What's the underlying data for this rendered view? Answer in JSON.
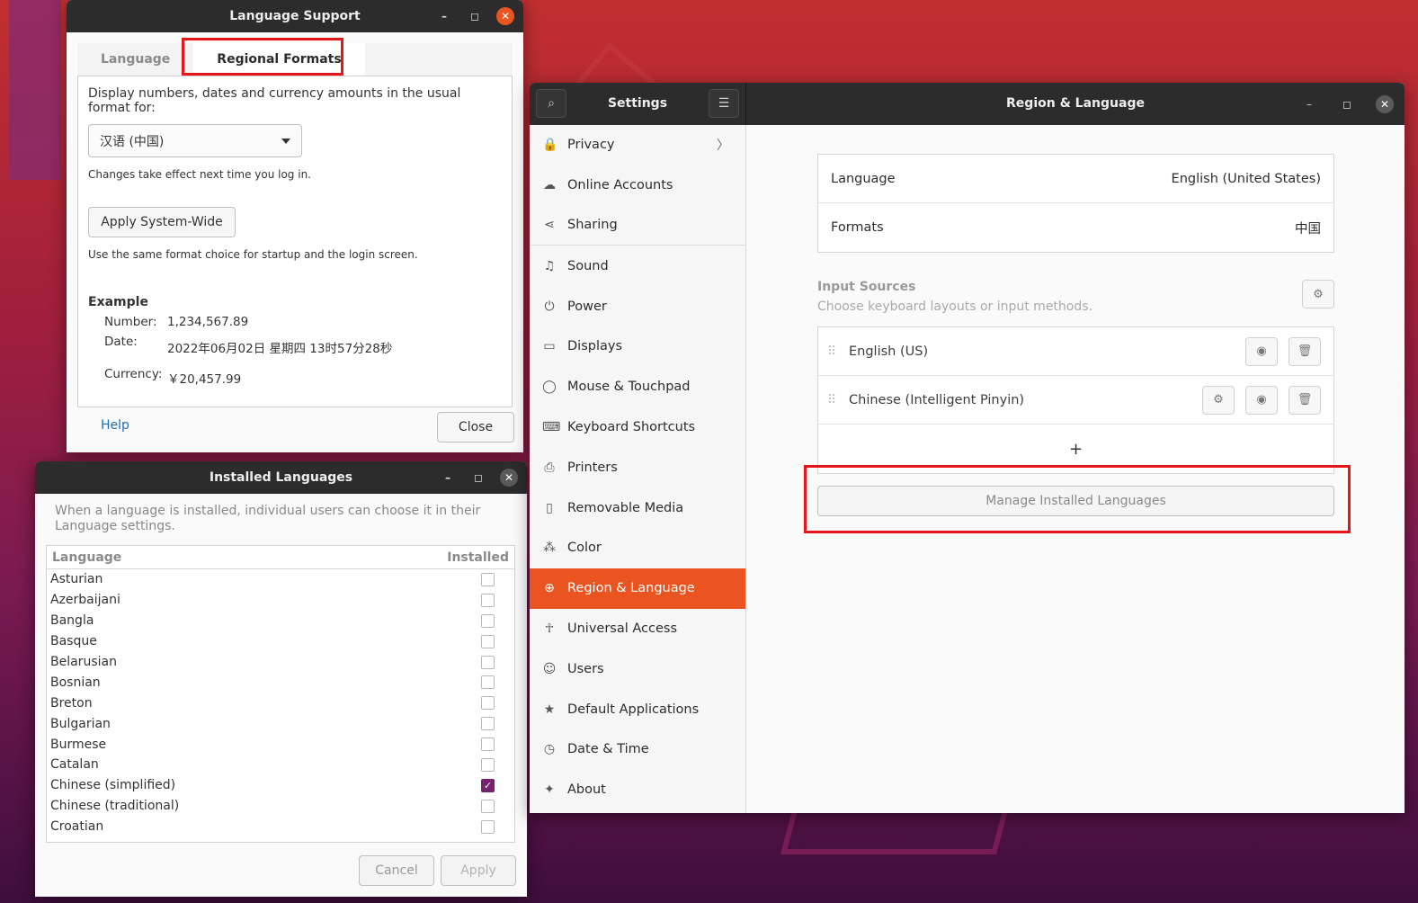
{
  "language_support": {
    "title": "Language Support",
    "tabs": [
      "Language",
      "Regional Formats"
    ],
    "prompt": "Display numbers, dates and currency amounts in the usual format for:",
    "selected_format": "汉语 (中国)",
    "note1": "Changes take effect next time you log in.",
    "apply_button": "Apply System-Wide",
    "note2": "Use the same format choice for startup and the login screen.",
    "example_title": "Example",
    "number_label": "Number:",
    "number_value": "1,234,567.89",
    "date_label": "Date:",
    "date_value": "2022年06月02日 星期四 13时57分28秒",
    "currency_label": "Currency:",
    "currency_value": "￥20,457.99",
    "help": "Help",
    "close": "Close"
  },
  "installed_languages": {
    "title": "Installed Languages",
    "description": "When a language is installed, individual users can choose it in their Language settings.",
    "col_language": "Language",
    "col_installed": "Installed",
    "rows": [
      {
        "name": "Asturian",
        "installed": false
      },
      {
        "name": "Azerbaijani",
        "installed": false
      },
      {
        "name": "Bangla",
        "installed": false
      },
      {
        "name": "Basque",
        "installed": false
      },
      {
        "name": "Belarusian",
        "installed": false
      },
      {
        "name": "Bosnian",
        "installed": false
      },
      {
        "name": "Breton",
        "installed": false
      },
      {
        "name": "Bulgarian",
        "installed": false
      },
      {
        "name": "Burmese",
        "installed": false
      },
      {
        "name": "Catalan",
        "installed": false
      },
      {
        "name": "Chinese (simplified)",
        "installed": true
      },
      {
        "name": "Chinese (traditional)",
        "installed": false
      },
      {
        "name": "Croatian",
        "installed": false
      }
    ],
    "cancel": "Cancel",
    "apply": "Apply"
  },
  "settings": {
    "title": "Settings",
    "page_title": "Region & Language",
    "sidebar": [
      {
        "label": "Privacy",
        "icon": "lock-icon",
        "glyph": "🔒",
        "chevron": true
      },
      {
        "label": "Online Accounts",
        "icon": "cloud-icon",
        "glyph": "☁"
      },
      {
        "label": "Sharing",
        "icon": "share-icon",
        "glyph": "⋖"
      },
      {
        "label": "Sound",
        "icon": "music-icon",
        "glyph": "♫"
      },
      {
        "label": "Power",
        "icon": "power-icon",
        "glyph": "⏻"
      },
      {
        "label": "Displays",
        "icon": "display-icon",
        "glyph": "▭"
      },
      {
        "label": "Mouse & Touchpad",
        "icon": "mouse-icon",
        "glyph": "◯"
      },
      {
        "label": "Keyboard Shortcuts",
        "icon": "keyboard-icon",
        "glyph": "⌨"
      },
      {
        "label": "Printers",
        "icon": "printer-icon",
        "glyph": "⎙"
      },
      {
        "label": "Removable Media",
        "icon": "media-icon",
        "glyph": "▯"
      },
      {
        "label": "Color",
        "icon": "color-icon",
        "glyph": "⁂"
      },
      {
        "label": "Region & Language",
        "icon": "globe-icon",
        "glyph": "⊕",
        "active": true
      },
      {
        "label": "Universal Access",
        "icon": "accessibility-icon",
        "glyph": "☥"
      },
      {
        "label": "Users",
        "icon": "users-icon",
        "glyph": "☺"
      },
      {
        "label": "Default Applications",
        "icon": "star-icon",
        "glyph": "★"
      },
      {
        "label": "Date & Time",
        "icon": "clock-icon",
        "glyph": "◷"
      },
      {
        "label": "About",
        "icon": "sparkle-icon",
        "glyph": "✦"
      }
    ],
    "language_label": "Language",
    "language_value": "English (United States)",
    "formats_label": "Formats",
    "formats_value": "中国",
    "input_sources_title": "Input Sources",
    "input_sources_sub": "Choose keyboard layouts or input methods.",
    "sources": [
      {
        "name": "English (US)",
        "has_settings": false
      },
      {
        "name": "Chinese (Intelligent Pinyin)",
        "has_settings": true
      }
    ],
    "add_symbol": "+",
    "manage_button": "Manage Installed Languages"
  },
  "colors": {
    "accent": "#e95420",
    "highlight_box": "#e8141a",
    "checkbox_checked": "#77216f"
  }
}
